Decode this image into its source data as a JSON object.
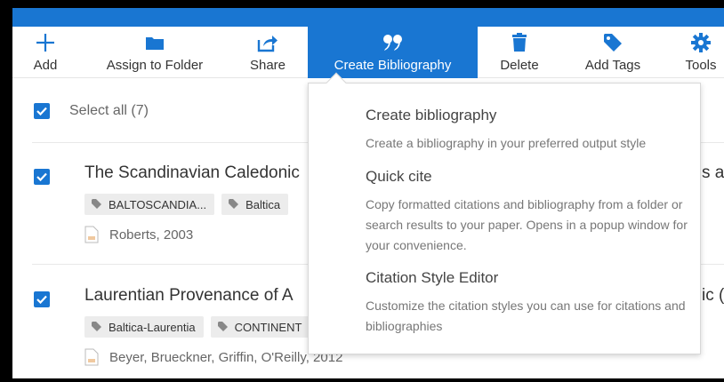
{
  "toolbar": {
    "items": [
      {
        "label": "Add",
        "icon": "plus-icon"
      },
      {
        "label": "Assign to Folder",
        "icon": "folder-icon"
      },
      {
        "label": "Share",
        "icon": "share-icon"
      },
      {
        "label": "Create Bibliography",
        "icon": "quote-icon",
        "active": true
      },
      {
        "label": "Delete",
        "icon": "trash-icon"
      },
      {
        "label": "Add Tags",
        "icon": "tag-icon"
      },
      {
        "label": "Tools",
        "icon": "gear-icon"
      }
    ]
  },
  "select_all": {
    "label": "Select all (7)",
    "checked": true
  },
  "records": [
    {
      "title": "The Scandinavian Caledonic",
      "title_tail": "s ar",
      "tags": [
        "BALTOSCANDIA...",
        "Baltica"
      ],
      "author": "Roberts, 2003",
      "checked": true
    },
    {
      "title": "Laurentian Provenance of A",
      "title_tail": "ic (",
      "tags": [
        "Baltica-Laurentia",
        "CONTINENT"
      ],
      "author": "Beyer, Brueckner, Griffin, O'Reilly, 2012",
      "checked": true
    }
  ],
  "dropdown": {
    "items": [
      {
        "title": "Create bibliography",
        "description": "Create a bibliography in your preferred output style"
      },
      {
        "title": "Quick cite",
        "description": "Copy formatted citations and bibliography from a folder or search results to your paper. Opens in a popup window for your convenience."
      },
      {
        "title": "Citation Style Editor",
        "description": "Customize the citation styles you can use for citations and bibliographies"
      }
    ]
  },
  "colors": {
    "accent": "#1976d2",
    "tag_bg": "#ececec",
    "text": "#333333",
    "muted": "#777777"
  }
}
